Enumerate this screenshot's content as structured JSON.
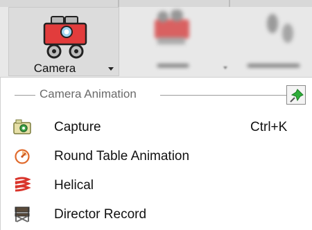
{
  "ribbon": {
    "camera_label": "Camera"
  },
  "menu": {
    "section_title": "Camera Animation",
    "items": [
      {
        "label": "Capture",
        "shortcut": "Ctrl+K",
        "icon": "camera-capture-icon"
      },
      {
        "label": "Round Table Animation",
        "shortcut": "",
        "icon": "round-table-animation-icon"
      },
      {
        "label": "Helical",
        "shortcut": "",
        "icon": "helical-icon"
      },
      {
        "label": "Director Record",
        "shortcut": "",
        "icon": "director-record-icon"
      }
    ]
  },
  "colors": {
    "camera_red": "#e23c3c",
    "pin_green": "#2fae3a",
    "helical_red": "#d9342b",
    "round_table_orange": "#e06a2c"
  }
}
